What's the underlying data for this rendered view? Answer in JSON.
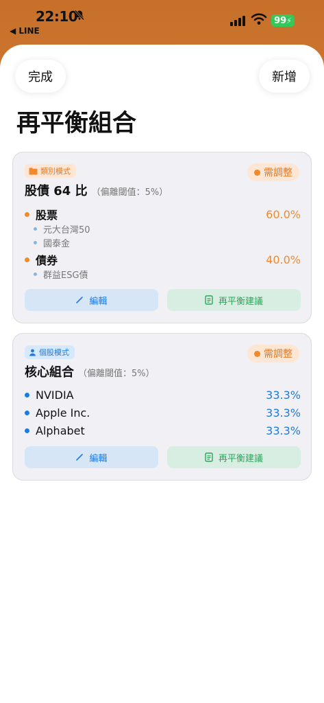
{
  "status_bar": {
    "time": "22:10",
    "back_app": "◀ LINE",
    "battery": "99"
  },
  "header": {
    "done_label": "完成",
    "add_label": "新增",
    "title": "再平衡組合"
  },
  "portfolios": [
    {
      "mode": "類別模式",
      "status": "需調整",
      "title": "股債 64 比",
      "threshold": "（偏離閾值：5%）",
      "categories": [
        {
          "name": "股票",
          "pct": "60.0%",
          "holdings": [
            "元大台灣50",
            "國泰金"
          ]
        },
        {
          "name": "債券",
          "pct": "40.0%",
          "holdings": [
            "群益ESG債"
          ]
        }
      ],
      "edit_label": "編輯",
      "rebalance_label": "再平衡建議"
    },
    {
      "mode": "個股模式",
      "status": "需調整",
      "title": "核心組合",
      "threshold": "（偏離閾值：5%）",
      "items": [
        {
          "name": "NVIDIA",
          "pct": "33.3%"
        },
        {
          "name": "Apple Inc.",
          "pct": "33.3%"
        },
        {
          "name": "Alphabet",
          "pct": "33.3%"
        }
      ],
      "edit_label": "編輯",
      "rebalance_label": "再平衡建議"
    }
  ],
  "colors": {
    "accent_orange": "#f08a2a",
    "accent_blue": "#1f7ae0",
    "accent_green": "#2aa55a",
    "battery_green": "#34c759"
  }
}
